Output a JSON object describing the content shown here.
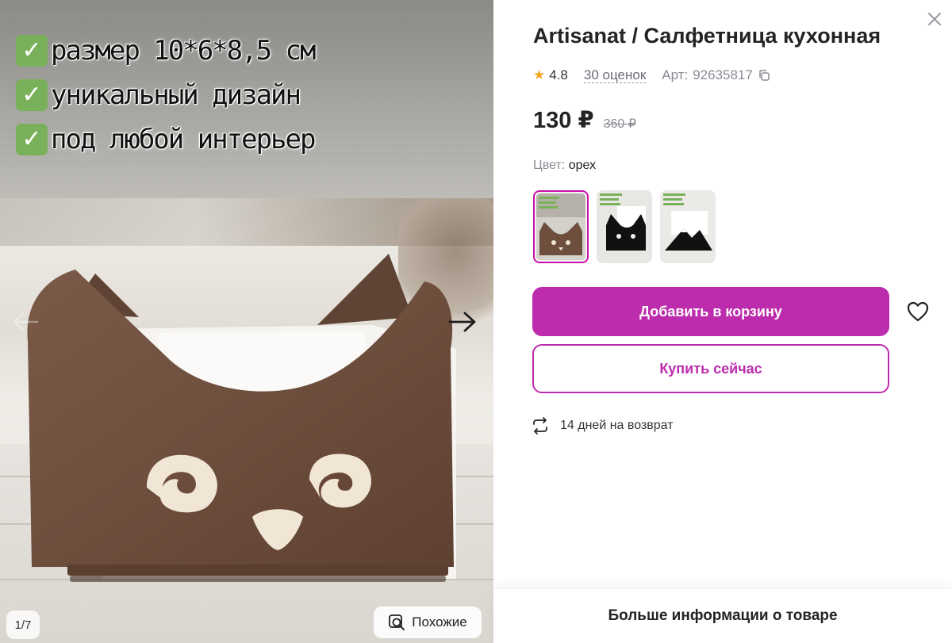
{
  "gallery": {
    "promo_lines": [
      "размер 10*6*8,5 см",
      "уникальный дизайн",
      "под любой интерьер"
    ],
    "counter": "1/7",
    "similar_label": "Похожие"
  },
  "product": {
    "title": "Artisanat / Салфетница кухонная",
    "rating": "4.8",
    "reviews": "30 оценок",
    "article_label": "Арт:",
    "article_value": "92635817",
    "price": "130 ₽",
    "old_price": "360 ₽",
    "color_label": "Цвет:",
    "color_value": "орех"
  },
  "actions": {
    "add_to_cart": "Добавить в корзину",
    "buy_now": "Купить сейчас"
  },
  "return_policy": "14 дней на возврат",
  "more_info": "Больше информации о товаре",
  "colors": {
    "accent": "#bd2cad",
    "star": "#f5a623"
  }
}
